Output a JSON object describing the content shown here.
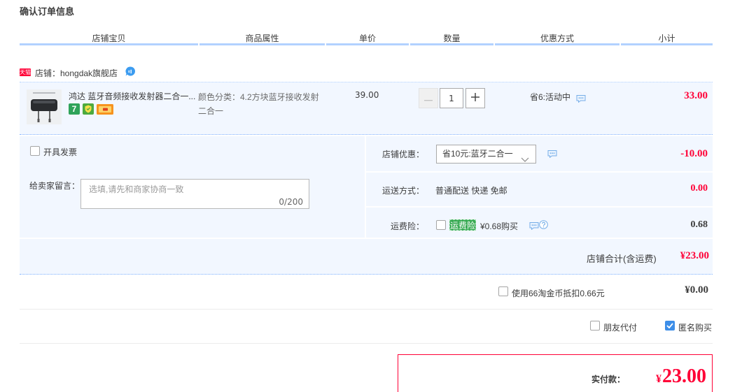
{
  "page": {
    "title": "确认订单信息"
  },
  "columns": [
    "店铺宝贝",
    "商品属性",
    "单价",
    "数量",
    "优惠方式",
    "小计"
  ],
  "store": {
    "platform_badge": "天猫",
    "label": "店铺：hongdak旗舰店"
  },
  "item": {
    "title": "鸿达 蓝牙音频接收发射器二合一...",
    "service_badge": "7",
    "attributes": "颜色分类：4.2方块蓝牙接收发射二合一",
    "unit_price": "39.00",
    "quantity": "1",
    "promotion": "省6:活动中",
    "subtotal": "33.00"
  },
  "invoice": {
    "label": "开具发票",
    "checked": false
  },
  "message": {
    "label": "给卖家留言：",
    "placeholder": "选填,请先和商家协商一致",
    "counter": "0/200"
  },
  "store_discount": {
    "label": "店铺优惠：",
    "selected": "省10元:蓝牙二合一",
    "amount": "-10.00"
  },
  "shipping": {
    "label": "运送方式：",
    "method": "普通配送 快递 免邮",
    "amount": "0.00"
  },
  "shipping_insurance": {
    "label": "运费险：",
    "checked": false,
    "badge": "运费险",
    "price_text": "¥0.68购买",
    "amount": "0.68"
  },
  "store_total": {
    "label": "店铺合计(含运费)",
    "amount": "¥23.00"
  },
  "coins": {
    "label": "使用66淘金币抵扣0.66元",
    "checked": false,
    "amount": "¥0.00"
  },
  "options": {
    "friend_pay": {
      "label": "朋友代付",
      "checked": false
    },
    "anonymous": {
      "label": "匿名购买",
      "checked": true
    }
  },
  "payment": {
    "label": "实付款：",
    "currency": "¥",
    "amount": "23.00"
  },
  "icons": {
    "store_chat": "chat-bubble-icon",
    "discount_chat": "chat-bubble-icon",
    "help": "question-icon",
    "guarantee": "guarantee-icon",
    "payment_card": "credit-card-icon",
    "select_arrow": "chevron-down-icon"
  },
  "colors": {
    "price_red": "#ff0036",
    "accent_blue": "#b2d1ff",
    "panel_bg": "#f2f7ff",
    "check_blue": "#3d8ee8",
    "insurance_green": "#3aab55"
  }
}
